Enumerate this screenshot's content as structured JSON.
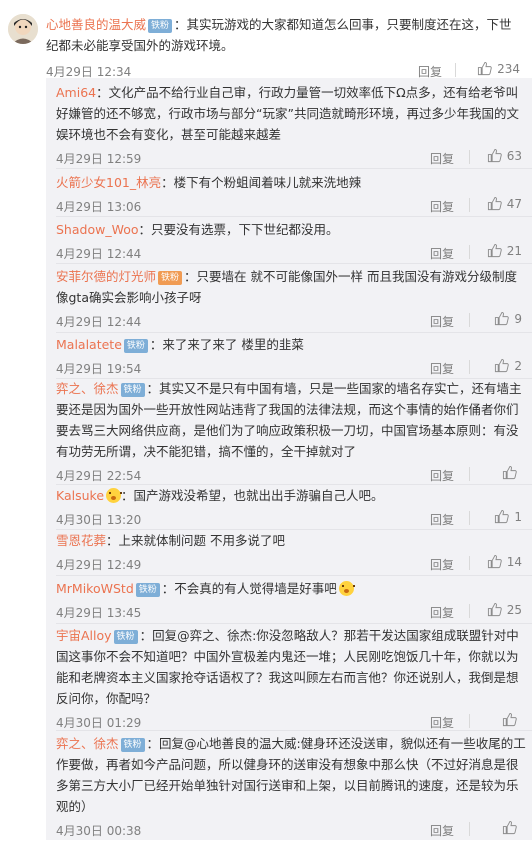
{
  "main_comment": {
    "user": "心地善良的温大威",
    "badge": "铁粉",
    "text": "：其实玩游戏的大家都知道怎么回事，只要制度还在这，下世纪都未必能享受国外的游戏环境。",
    "time": "4月29日 12:34",
    "reply_label": "回复",
    "likes": "234"
  },
  "replies": [
    {
      "user": "Ami64",
      "badge": "",
      "text": "：文化产品不给行业自己审，行政力量管一切效率低下Ω点多，还有给老爷叫好嫌管的还不够宽，行政市场与部分“玩家”共同造就畸形环境，再过多少年我国的文娱环境也不会有变化，甚至可能越来越差",
      "time": "4月29日 12:59",
      "reply_label": "回复",
      "likes": "63"
    },
    {
      "user": "火箭少女101_林亮",
      "badge": "",
      "text": "：楼下有个粉蛆闻着味儿就来洗地辣",
      "time": "4月29日 13:06",
      "reply_label": "回复",
      "likes": "47"
    },
    {
      "user": "Shadow_Woo",
      "badge": "",
      "text": "：只要没有选票，下下世纪都没用。",
      "time": "4月29日 12:44",
      "reply_label": "回复",
      "likes": "21"
    },
    {
      "user": "安菲尔德的灯光师",
      "badge": "铁粉",
      "badge_style": "vip",
      "text": "：只要墙在 就不可能像国外一样 而且我国没有游戏分级制度 像gta确实会影响小孩子呀",
      "time": "4月29日 12:44",
      "reply_label": "回复",
      "likes": "9"
    },
    {
      "user": "Malalatete",
      "badge": "铁粉",
      "text": "：来了来了来了 楼里的韭菜",
      "time": "4月29日 19:54",
      "reply_label": "回复",
      "likes": "2"
    },
    {
      "user": "弈之、徐杰",
      "badge": "铁粉",
      "text": "：其实又不是只有中国有墙，只是一些国家的墙名存实亡，还有墙主要还是因为国外一些开放性网站违背了我国的法律法规，而这个事情的始作俑者你们要去骂三大网络供应商，是他们为了响应政策积极一刀切，中国官场基本原则：有没有功劳无所谓，决不能犯错，搞不懂的，全干掉就对了",
      "time": "4月29日 22:54",
      "reply_label": "回复",
      "likes": ""
    },
    {
      "user": "Kalsuke",
      "badge": "",
      "text": "：国产游戏没希望，也就出出手游骗自己人吧。",
      "time": "4月30日 13:20",
      "reply_label": "回复",
      "likes": "1"
    },
    {
      "user": "雪恩花葬",
      "badge": "",
      "text": "：上来就体制问题 不用多说了吧",
      "time": "4月29日 12:49",
      "reply_label": "回复",
      "likes": "14"
    },
    {
      "user": "MrMikoWStd",
      "badge": "铁粉",
      "text": "：不会真的有人觉得墙是好事吧",
      "time": "4月29日 13:45",
      "reply_label": "回复",
      "likes": "25"
    },
    {
      "user": "宇宙Alloy",
      "badge": "铁粉",
      "text": "：回复@弈之、徐杰:你没忽略敌人？那若干发达国家组成联盟针对中国这事你不会不知道吧？中国外宣极差内鬼还一堆；人民刚吃饱饭几十年，你就以为能和老牌资本主义国家抢夺话语权了？我这叫顾左右而言他？你还说别人，我倒是想反问你，你配吗？",
      "time": "4月30日 01:29",
      "reply_label": "回复",
      "likes": ""
    },
    {
      "user": "弈之、徐杰",
      "badge": "铁粉",
      "text": "：回复@心地善良的温大威:健身环还没送审，貌似还有一些收尾的工作要做，再者如今产品问题，所以健身环的送审没有想象中那么快（不过好消息是很多第三方大小厂已经开始单独针对国行送审和上架，以目前腾讯的速度，还是较为乐观的）",
      "time": "4月30日 00:38",
      "reply_label": "回复",
      "likes": ""
    }
  ],
  "colors": {
    "username": "#eb7350",
    "reply_bg": "#f2f2f5",
    "meta": "#808080"
  },
  "icons": {
    "like": "thumbs-up-icon",
    "emoji": "surprised-emoji-icon"
  }
}
